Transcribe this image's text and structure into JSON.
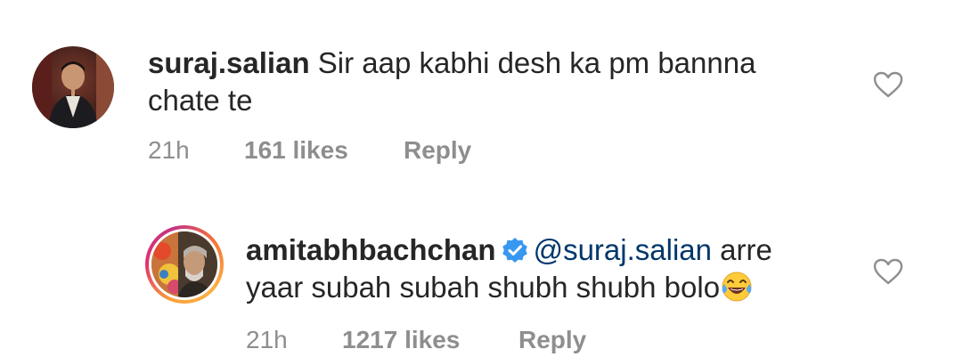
{
  "comments": [
    {
      "username": "suraj.salian",
      "text_line1": " Sir aap kabhi desh ka pm bannna",
      "text_line2": "chate te",
      "time": "21h",
      "likes": "161 likes",
      "reply_label": "Reply",
      "avatar_icon": "profile-photo",
      "like_icon": "heart-outline-icon"
    },
    {
      "username": "amitabhbachchan",
      "verified_icon": "verified-badge-icon",
      "mention": "@suraj.salian",
      "text_line1_rest": " arre",
      "text_line2": "yaar subah subah shubh shubh bolo",
      "emoji": "face-with-tears-of-joy",
      "time": "21h",
      "likes": "1217 likes",
      "reply_label": "Reply",
      "avatar_icon": "profile-photo-with-story-ring",
      "like_icon": "heart-outline-icon"
    }
  ],
  "colors": {
    "text": "#262626",
    "meta": "#8e8e8e",
    "mention": "#00376b",
    "verified": "#3897f0"
  }
}
